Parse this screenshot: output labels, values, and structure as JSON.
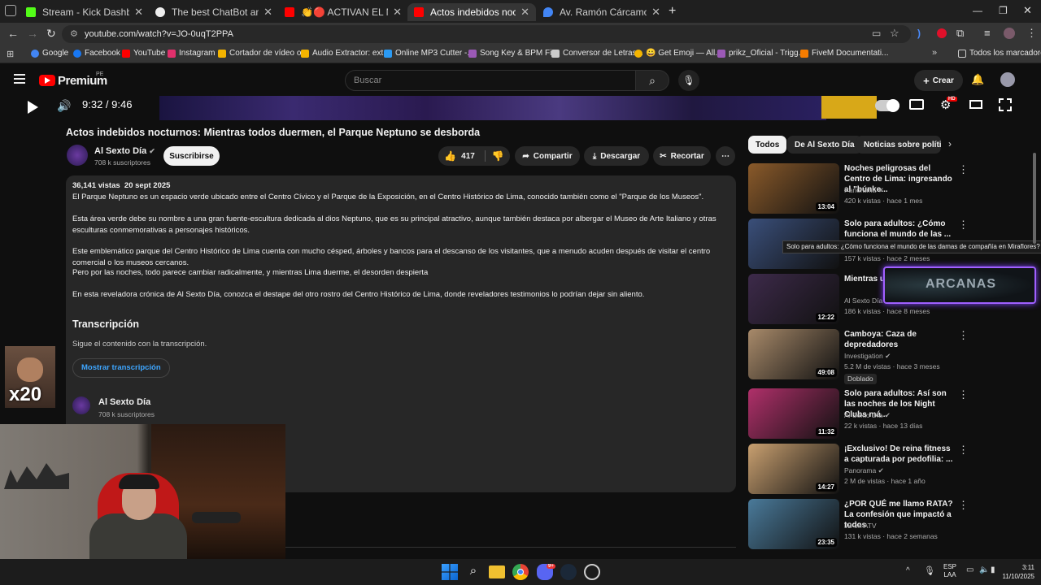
{
  "tabs": [
    {
      "label": "Stream - Kick Dashboard",
      "color": "#53fc18"
    },
    {
      "label": "The best ChatBot and Widgets",
      "color": "#ffffff"
    },
    {
      "label": "👏🔴 ACTIVAN EL MODO SEG",
      "color": "#ff0000"
    },
    {
      "label": "Actos indebidos nocturnos: Mie",
      "color": "#ff0000"
    },
    {
      "label": "Av. Ramón Cárcamo & Av. Arge",
      "color": "#4285f4"
    }
  ],
  "address": {
    "url": "youtube.com/watch?v=JO-0uqT2PPA"
  },
  "bookmarks": [
    {
      "label": "Google",
      "color": "#4285f4"
    },
    {
      "label": "Facebook",
      "color": "#1877f2"
    },
    {
      "label": "YouTube",
      "color": "#ff0000"
    },
    {
      "label": "Instagram",
      "color": "#e1306c"
    },
    {
      "label": "Cortador de vídeo o...",
      "color": "#f4b400"
    },
    {
      "label": "Audio Extractor: ext...",
      "color": "#f4b400"
    },
    {
      "label": "Online MP3 Cutter -...",
      "color": "#2b9af3"
    },
    {
      "label": "Song Key & BPM Fi...",
      "color": "#9b59b6"
    },
    {
      "label": "Conversor de Letras...",
      "color": "#cccccc"
    },
    {
      "label": "😀 Get Emoji — All...",
      "color": "#f4b400"
    },
    {
      "label": "prikz_Oficial - Trigg...",
      "color": "#9b59b6"
    },
    {
      "label": "FiveM Documentati...",
      "color": "#f57c00"
    }
  ],
  "bookmarks_all": "Todos los marcadores",
  "yt": {
    "logo": "Premium",
    "region": "PE",
    "search_placeholder": "Buscar",
    "create": "Crear"
  },
  "player": {
    "time": "9:32 / 9:46",
    "progress": 0.975
  },
  "video": {
    "title": "Actos indebidos nocturnos: Mientras todos duermen, el Parque Neptuno se desborda",
    "channel": "Al Sexto Día",
    "subscribers": "708 k suscriptores",
    "subscribe": "Suscribirse",
    "likes": "417",
    "share": "Compartir",
    "download": "Descargar",
    "clip": "Recortar"
  },
  "description": {
    "views": "36,141 vistas",
    "date": "20 sept 2025",
    "p1": "El Parque Neptuno es un espacio verde ubicado entre el Centro Cívico y el Parque de la Exposición, en el Centro Histórico de Lima, conocido también como el \"Parque de los Museos\".",
    "p2": "Esta área verde debe su nombre a una gran fuente-escultura dedicada al dios Neptuno, que es su principal atractivo, aunque también destaca por albergar el Museo de Arte Italiano y otras esculturas conmemorativas a personajes históricos.",
    "p3a": "Este emblemático parque del Centro Histórico de Lima cuenta con mucho césped, árboles y bancos para el descanso de los visitantes, que a menudo acuden después de visitar el centro comercial o los museos cercanos.",
    "p3b": "Pero por las noches, todo parece cambiar radicalmente, y mientras Lima duerme, el desorden despierta",
    "p4": "En esta reveladora crónica de Al Sexto Día, conozca el destape del otro rostro del Centro Histórico de Lima, donde reveladores testimonios lo podrían dejar sin aliento.",
    "transcript_title": "Transcripción",
    "transcript_sub": "Sigue el contenido con la transcripción.",
    "transcript_button": "Mostrar transcripción",
    "channel": "Al Sexto Día",
    "subscribers": "708 k suscriptores"
  },
  "chips": [
    "Todos",
    "De Al Sexto Día",
    "Noticias sobre política"
  ],
  "tooltip": "Solo para adultos: ¿Cómo funciona el mundo de las damas de compañía en Miraflores?",
  "recs": [
    {
      "title": "Noches peligrosas del Centro de Lima: ingresando al \"búnke...",
      "channel": "Panorama",
      "stats": "420 k vistas · hace 1 mes",
      "duration": "13:04",
      "thumb": "#8a5a2a",
      "verified": true
    },
    {
      "title": "Solo para adultos: ¿Cómo funciona el mundo de las ...",
      "channel": "",
      "stats": "157 k vistas · hace 2 meses",
      "duration": "",
      "thumb": "#3a4f7a",
      "verified": false
    },
    {
      "title": "Mientras u las calles c",
      "channel": "Al Sexto Día",
      "stats": "186 k vistas · hace 8 meses",
      "duration": "12:22",
      "thumb": "#3d2a4a",
      "verified": false
    },
    {
      "title": "Camboya: Caza de depredadores",
      "channel": "Investigation",
      "stats": "5.2 M de vistas · hace 3 meses",
      "duration": "49:08",
      "thumb": "#a88a6a",
      "verified": true,
      "badge": "Doblado"
    },
    {
      "title": "Solo para adultos: Así son las noches de los Night Clubs má...",
      "channel": "Al Sexto Día",
      "stats": "22 k vistas · hace 13 días",
      "duration": "11:32",
      "thumb": "#b0306a",
      "verified": true
    },
    {
      "title": "¡Exclusivo! De reina fitness a capturada por pedofilia: ...",
      "channel": "Panorama",
      "stats": "2 M de vistas · hace 1 año",
      "duration": "14:27",
      "thumb": "#c9a070",
      "verified": true
    },
    {
      "title": "¿POR QUÉ me llamo RATA? La confesión que impactó a todos",
      "channel": "JB en ATV",
      "stats": "131 k vistas · hace 2 semanas",
      "duration": "23:35",
      "thumb": "#4a7a9a",
      "verified": false
    }
  ],
  "overlay": {
    "multiplier": "x20",
    "arcanas": "ARCANAS"
  },
  "taskbar": {
    "lang1": "ESP",
    "lang2": "LAA",
    "time": "3:11",
    "date": "11/10/2025",
    "badge": "9+"
  }
}
